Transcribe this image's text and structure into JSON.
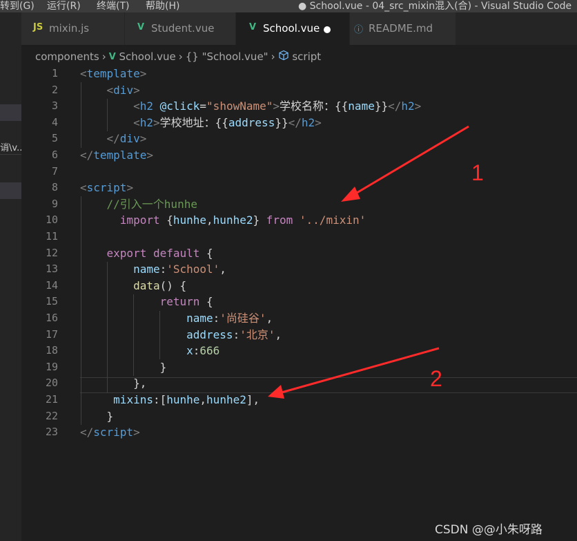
{
  "menu": {
    "items": [
      "转到(G)",
      "运行(R)",
      "终端(T)",
      "帮助(H)"
    ],
    "window_title": "● School.vue - 04_src_mixin混入(合) - Visual Studio Code"
  },
  "sidebar": {
    "fragment": "诮\\v..."
  },
  "tabs": [
    {
      "icon": "JS",
      "label": "mixin.js"
    },
    {
      "icon": "V",
      "label": "Student.vue"
    },
    {
      "icon": "V",
      "label": "School.vue",
      "active": true,
      "modified": true
    },
    {
      "icon": "ⓘ",
      "label": "README.md"
    }
  ],
  "breadcrumb": {
    "folder": "components",
    "file": "School.vue",
    "object": "\"School.vue\"",
    "object_icon": "{}",
    "section": "script"
  },
  "editor": {
    "current_line": 20,
    "lines": [
      [
        [
          "br",
          "<"
        ],
        [
          "tg",
          "template"
        ],
        [
          "br",
          ">"
        ]
      ],
      [
        [
          "pl",
          "    "
        ],
        [
          "br",
          "<"
        ],
        [
          "tg",
          "div"
        ],
        [
          "br",
          ">"
        ]
      ],
      [
        [
          "pl",
          "        "
        ],
        [
          "br",
          "<"
        ],
        [
          "tg",
          "h2"
        ],
        [
          "pl",
          " "
        ],
        [
          "at",
          "@click"
        ],
        [
          "pl",
          "="
        ],
        [
          "st",
          "\"showName\""
        ],
        [
          "br",
          ">"
        ],
        [
          "pl",
          "学校名称：{{"
        ],
        [
          "mus",
          "name"
        ],
        [
          "pl",
          "}}"
        ],
        [
          "br",
          "</"
        ],
        [
          "tg",
          "h2"
        ],
        [
          "br",
          ">"
        ]
      ],
      [
        [
          "pl",
          "        "
        ],
        [
          "br",
          "<"
        ],
        [
          "tg",
          "h2"
        ],
        [
          "br",
          ">"
        ],
        [
          "pl",
          "学校地址：{{"
        ],
        [
          "mus",
          "address"
        ],
        [
          "pl",
          "}}"
        ],
        [
          "br",
          "</"
        ],
        [
          "tg",
          "h2"
        ],
        [
          "br",
          ">"
        ]
      ],
      [
        [
          "pl",
          "    "
        ],
        [
          "br",
          "</"
        ],
        [
          "tg",
          "div"
        ],
        [
          "br",
          ">"
        ]
      ],
      [
        [
          "br",
          "</"
        ],
        [
          "tg",
          "template"
        ],
        [
          "br",
          ">"
        ]
      ],
      [
        [
          "pl",
          ""
        ]
      ],
      [
        [
          "br",
          "<"
        ],
        [
          "tg",
          "script"
        ],
        [
          "br",
          ">"
        ]
      ],
      [
        [
          "pl",
          "    "
        ],
        [
          "cm",
          "//引入一个hunhe"
        ]
      ],
      [
        [
          "pl",
          "      "
        ],
        [
          "kw",
          "import"
        ],
        [
          "pl",
          " {"
        ],
        [
          "id",
          "hunhe"
        ],
        [
          "pl",
          ","
        ],
        [
          "id",
          "hunhe2"
        ],
        [
          "pl",
          "} "
        ],
        [
          "kw",
          "from"
        ],
        [
          "pl",
          " "
        ],
        [
          "st",
          "'../mixin'"
        ]
      ],
      [
        [
          "pl",
          ""
        ]
      ],
      [
        [
          "pl",
          "    "
        ],
        [
          "kw",
          "export"
        ],
        [
          "pl",
          " "
        ],
        [
          "kw",
          "default"
        ],
        [
          "pl",
          " {"
        ]
      ],
      [
        [
          "pl",
          "        "
        ],
        [
          "id",
          "name"
        ],
        [
          "pl",
          ":"
        ],
        [
          "st",
          "'School'"
        ],
        [
          "pl",
          ","
        ]
      ],
      [
        [
          "pl",
          "        "
        ],
        [
          "fn",
          "data"
        ],
        [
          "pl",
          "() {"
        ]
      ],
      [
        [
          "pl",
          "            "
        ],
        [
          "kw",
          "return"
        ],
        [
          "pl",
          " {"
        ]
      ],
      [
        [
          "pl",
          "                "
        ],
        [
          "id",
          "name"
        ],
        [
          "pl",
          ":"
        ],
        [
          "st",
          "'尚硅谷'"
        ],
        [
          "pl",
          ","
        ]
      ],
      [
        [
          "pl",
          "                "
        ],
        [
          "id",
          "address"
        ],
        [
          "pl",
          ":"
        ],
        [
          "st",
          "'北京'"
        ],
        [
          "pl",
          ","
        ]
      ],
      [
        [
          "pl",
          "                "
        ],
        [
          "id",
          "x"
        ],
        [
          "pl",
          ":"
        ],
        [
          "nm",
          "666"
        ]
      ],
      [
        [
          "pl",
          "            }"
        ]
      ],
      [
        [
          "pl",
          "        },"
        ]
      ],
      [
        [
          "pl",
          "     "
        ],
        [
          "id",
          "mixins"
        ],
        [
          "pl",
          ":["
        ],
        [
          "id",
          "hunhe"
        ],
        [
          "pl",
          ","
        ],
        [
          "id",
          "hunhe2"
        ],
        [
          "pl",
          "],"
        ]
      ],
      [
        [
          "pl",
          "    }"
        ]
      ],
      [
        [
          "br",
          "</"
        ],
        [
          "tg",
          "script"
        ],
        [
          "br",
          ">"
        ]
      ]
    ]
  },
  "annotations": {
    "label1": "1",
    "label2": "2",
    "color": "#ff2a2a"
  },
  "watermark": "CSDN @@小朱呀路"
}
